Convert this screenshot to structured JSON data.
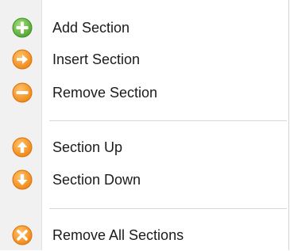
{
  "menu": {
    "items": [
      {
        "label": "Add Section",
        "icon": "plus-circle-icon",
        "color": "#6cc04a"
      },
      {
        "label": "Insert Section",
        "icon": "arrow-right-circle-icon",
        "color": "#f28f1c"
      },
      {
        "label": "Remove Section",
        "icon": "minus-circle-icon",
        "color": "#f28f1c"
      },
      {
        "label": "Section Up",
        "icon": "arrow-up-circle-icon",
        "color": "#f28f1c"
      },
      {
        "label": "Section Down",
        "icon": "arrow-down-circle-icon",
        "color": "#f28f1c"
      },
      {
        "label": "Remove All Sections",
        "icon": "x-circle-icon",
        "color": "#f28f1c"
      }
    ]
  }
}
